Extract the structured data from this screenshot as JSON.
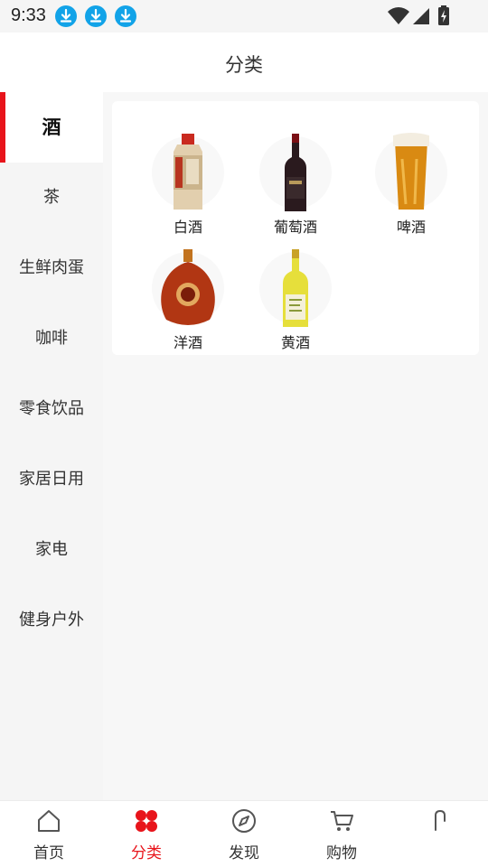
{
  "status_bar": {
    "time": "9:33",
    "download_icon_count": 3
  },
  "header": {
    "title": "分类"
  },
  "sidebar": {
    "items": [
      {
        "label": "酒",
        "active": true
      },
      {
        "label": "茶",
        "active": false
      },
      {
        "label": "生鲜肉蛋",
        "active": false
      },
      {
        "label": "咖啡",
        "active": false
      },
      {
        "label": "零食饮品",
        "active": false
      },
      {
        "label": "家居日用",
        "active": false
      },
      {
        "label": "家电",
        "active": false
      },
      {
        "label": "健身户外",
        "active": false
      }
    ]
  },
  "subcategories": [
    {
      "label": "白酒",
      "icon": "baijiu-bottle-image"
    },
    {
      "label": "葡萄酒",
      "icon": "wine-bottle-image"
    },
    {
      "label": "啤酒",
      "icon": "beer-glass-image"
    },
    {
      "label": "洋酒",
      "icon": "xo-bottle-image"
    },
    {
      "label": "黄酒",
      "icon": "yellow-wine-bottle-image"
    }
  ],
  "bottom_nav": {
    "tabs": [
      {
        "label": "首页",
        "icon": "home-icon",
        "active": false
      },
      {
        "label": "分类",
        "icon": "category-icon",
        "active": true
      },
      {
        "label": "发现",
        "icon": "compass-icon",
        "active": false
      },
      {
        "label": "购物",
        "icon": "cart-icon",
        "active": false
      },
      {
        "label": "",
        "icon": "profile-icon",
        "active": false
      }
    ]
  },
  "colors": {
    "accent": "#e8141b",
    "download_badge": "#12a3e8"
  }
}
